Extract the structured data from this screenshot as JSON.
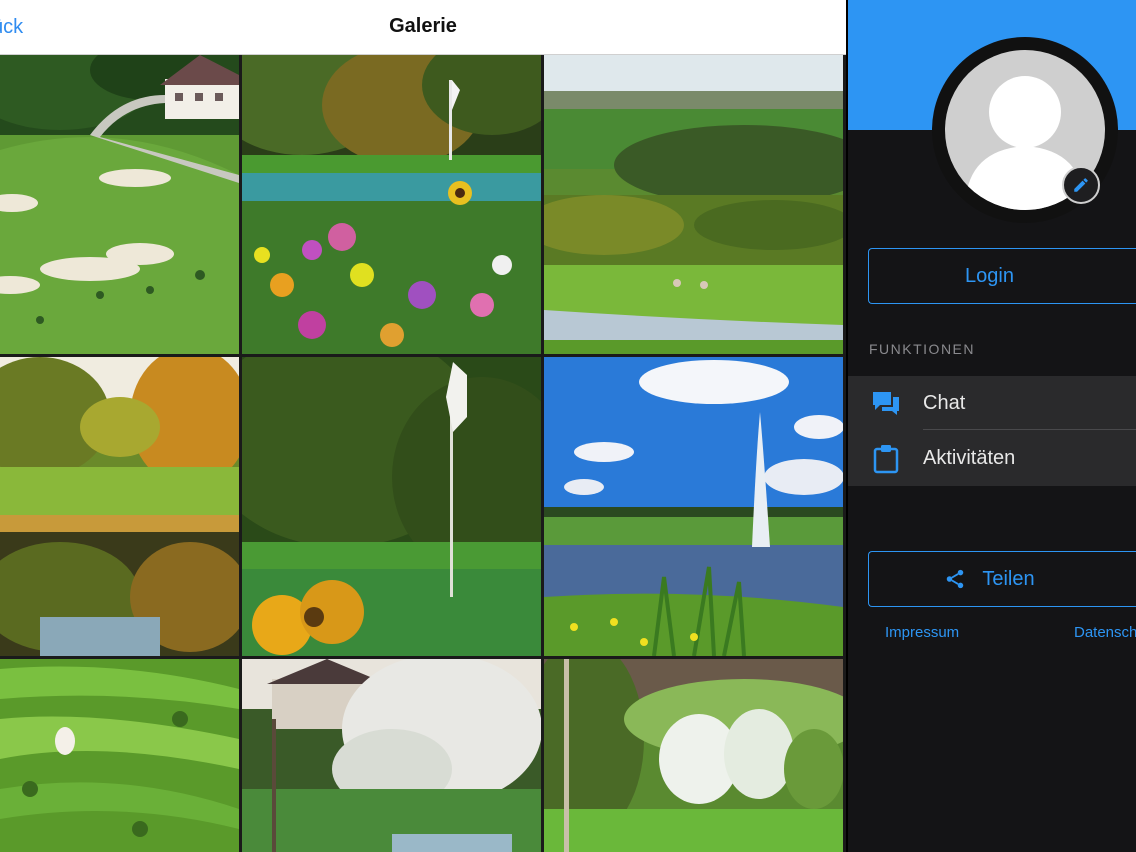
{
  "navbar": {
    "back_label": "ück",
    "title": "Galerie"
  },
  "gallery": {
    "images": [
      "golf-course-clubhouse",
      "flag-with-flowers",
      "fairway-with-pond",
      "autumn-pond",
      "flag-closeup-sunflower",
      "lake-fountain",
      "aerial-fairways",
      "blossom-tree-house",
      "blossom-trees-meadow"
    ]
  },
  "menu": {
    "login_label": "Login",
    "section_label": "FUNKTIONEN",
    "items": [
      {
        "label": "Chat",
        "icon": "chat-icon"
      },
      {
        "label": "Aktivitäten",
        "icon": "clipboard-icon"
      }
    ],
    "share_label": "Teilen",
    "footer": {
      "impressum": "Impressum",
      "datenschutz": "Datensch"
    }
  },
  "colors": {
    "accent": "#2d95f3",
    "menu_bg": "#141416",
    "item_bg": "#2a2a2c"
  }
}
